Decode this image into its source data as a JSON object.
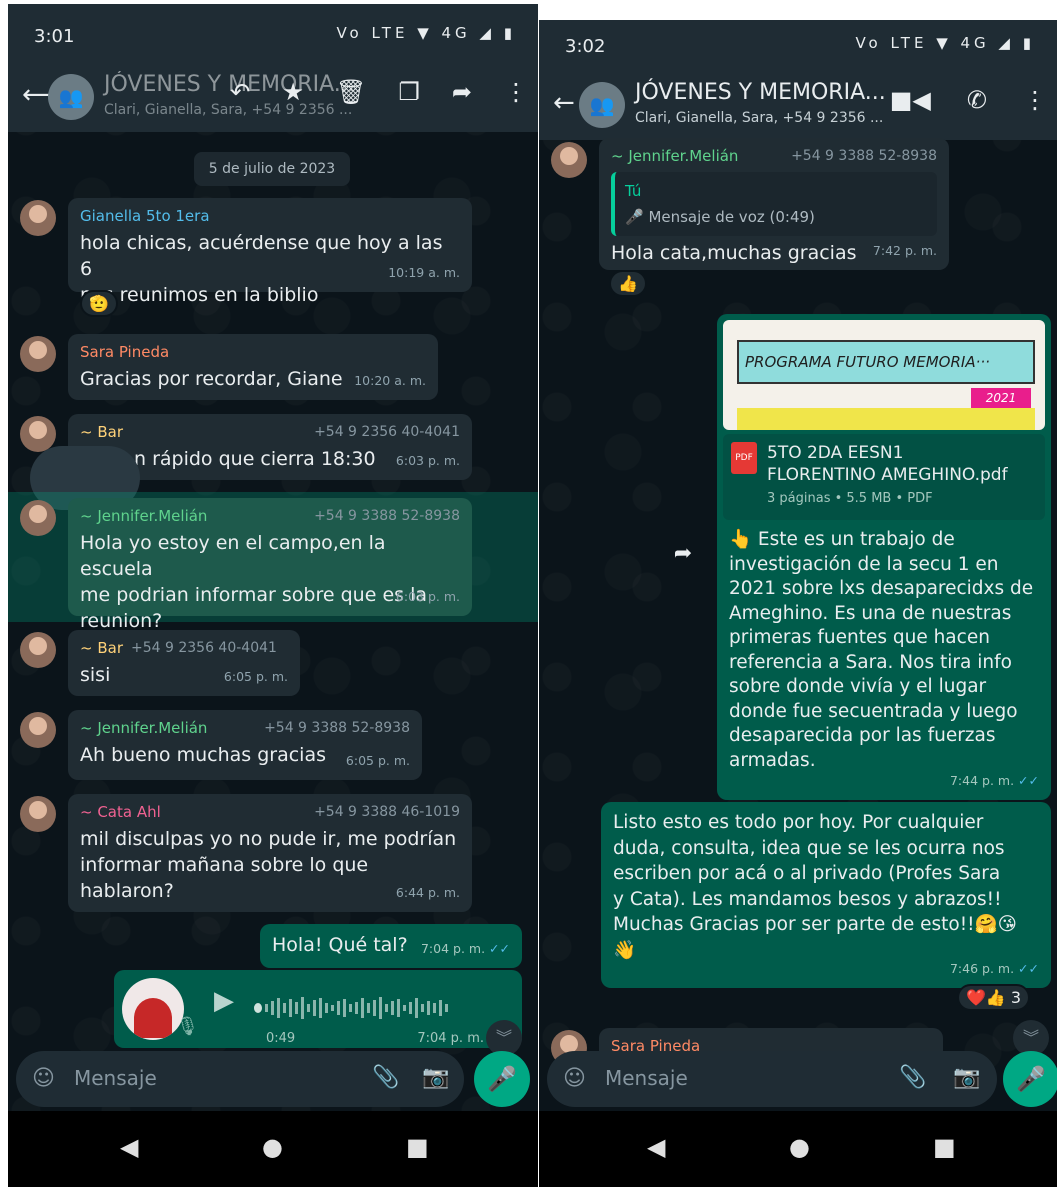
{
  "left": {
    "status": {
      "time": "3:01",
      "icons": "Vo LTE ▼ 4G ◢ ▮"
    },
    "header": {
      "title": "JÓVENES Y MEMORIA...",
      "subtitle": "Clari, Gianella, Sara, +54 9 2356 ..."
    },
    "date_chip": "5 de julio de 2023",
    "messages": [
      {
        "sender": "Gianella 5to 1era",
        "text": "hola chicas, acuérdense que hoy a las 6\nnos reunimos en la biblio",
        "time": "10:19 a. m."
      },
      {
        "sender": "Sara Pineda",
        "text": "Gracias por recordar, Giane",
        "time": "10:20 a. m."
      },
      {
        "sender": "~ Bar",
        "phone": "+54 9 2356 40-4041",
        "text": "n rápido que cierra 18:30",
        "time": "6:03 p. m."
      },
      {
        "sender": "~ Jennifer.Melián",
        "phone": "+54 9 3388 52-8938",
        "text": "Hola yo estoy en el campo,en la escuela\nme podrian informar sobre que es la\nreunion?",
        "time": "6:03 p. m."
      },
      {
        "sender": "~ Bar",
        "phone": "+54 9 2356 40-4041",
        "text": "sisi",
        "time": "6:05 p. m."
      },
      {
        "sender": "~ Jennifer.Melián",
        "phone": "+54 9 3388 52-8938",
        "text": "Ah bueno muchas gracias",
        "time": "6:05 p. m."
      },
      {
        "sender": "~ Cata Ahl",
        "phone": "+54 9 3388 46-1019",
        "text": "mil disculpas yo no pude ir, me podrían\ninformar mañana sobre lo que hablaron?",
        "time": "6:44 p. m."
      },
      {
        "text": "Hola! Qué tal?",
        "time": "7:04 p. m."
      }
    ],
    "voice": {
      "duration": "0:49",
      "time": "7:04 p. m."
    },
    "reaction_1": "🫡",
    "composer_placeholder": "Mensaje"
  },
  "right": {
    "status": {
      "time": "3:02",
      "icons": "Vo LTE ▼ 4G ◢ ▮"
    },
    "header": {
      "title": "JÓVENES Y MEMORIA...",
      "subtitle": "Clari, Gianella, Sara, +54 9 2356 ..."
    },
    "msg1": {
      "sender": "~ Jennifer.Melián",
      "phone": "+54 9 3388 52-8938",
      "quote_name": "Tú",
      "quote_text": "🎤 Mensaje de voz (0:49)",
      "text": "Hola cata,muchas gracias",
      "time": "7:42 p. m.",
      "reaction": "👍"
    },
    "doc": {
      "banner": "PROGRAMA FUTURO MEMORIA···",
      "banner_year": "2021",
      "badge": "PDF",
      "name": "5TO 2DA EESN1\nFLORENTINO AMEGHINO.pdf",
      "meta": "3 páginas • 5.5 MB • PDF"
    },
    "caption": {
      "text": "👆 Este es un trabajo de\ninvestigación de la secu 1 en\n2021 sobre lxs desaparecidxs de\nAmeghino. Es una de nuestras\nprimeras fuentes que hacen\nreferencia a Sara. Nos tira info\nsobre donde vivía y el lugar\ndonde fue secuentrada y luego\ndesaparecida por las fuerzas\narmadas.",
      "time": "7:44 p. m."
    },
    "msg2": {
      "text": "Listo esto es todo por hoy.  Por cualquier\nduda, consulta, idea que se les ocurra nos\nescriben por acá o al privado (Profes Sara\ny Cata). Les mandamos besos y abrazos!!\nMuchas Gracias por ser parte de esto!!🤗😘\n👋",
      "time": "7:46 p. m.",
      "reactions": "❤️👍 3"
    },
    "last_sender": "Sara Pineda",
    "composer_placeholder": "Mensaje"
  }
}
